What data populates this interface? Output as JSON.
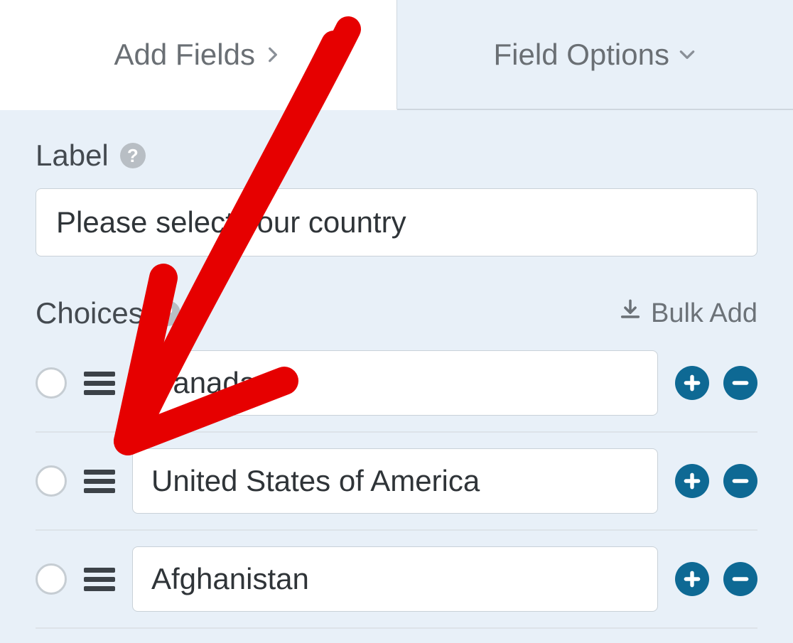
{
  "tabs": {
    "add_fields": "Add Fields",
    "field_options": "Field Options"
  },
  "label_section": {
    "title": "Label",
    "value": "Please select your country"
  },
  "choices_section": {
    "title": "Choices",
    "bulk_add": "Bulk Add"
  },
  "choices": [
    {
      "value": "Canada"
    },
    {
      "value": "United States of America"
    },
    {
      "value": "Afghanistan"
    }
  ]
}
